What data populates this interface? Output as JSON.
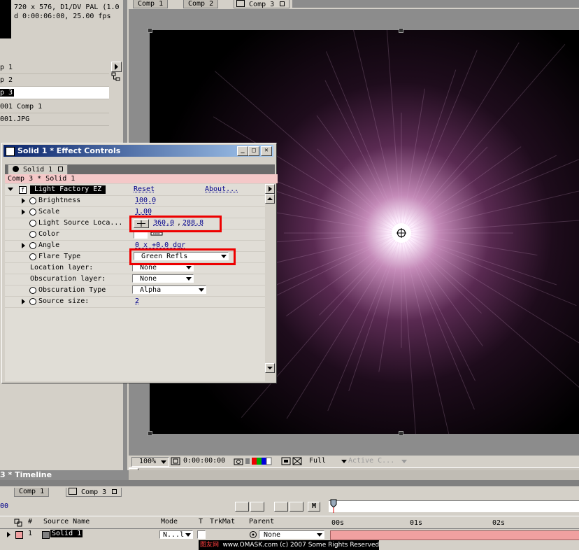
{
  "project": {
    "info_line1": "720 x 576, D1/DV PAL (1.0",
    "info_line2": "d 0:00:06:00, 25.00 fps",
    "items": [
      {
        "label": "p 1",
        "selected": false
      },
      {
        "label": "p 2",
        "selected": false
      },
      {
        "label": "p 3",
        "selected": true
      },
      {
        "label": "001 Comp 1",
        "selected": false
      },
      {
        "label": "001.JPG",
        "selected": false
      }
    ]
  },
  "comp_viewer": {
    "tabs": [
      "Comp 1",
      "Comp 2",
      "Comp 3"
    ],
    "active_tab": "Comp 3",
    "zoom": "100%",
    "timecode": "0:00:00:00",
    "resolution": "Full",
    "camera": "Active C..."
  },
  "effect_controls": {
    "title": "Solid 1 * Effect Controls",
    "tab": "Solid 1",
    "path": "Comp 3 * Solid 1",
    "effect_name": "Light Factory EZ",
    "reset_label": "Reset",
    "about_label": "About...",
    "params": {
      "brightness": {
        "label": "Brightness",
        "value": "100.0"
      },
      "scale": {
        "label": "Scale",
        "value": "1.00"
      },
      "light_source": {
        "label": "Light Source Loca...",
        "x": "360.0",
        "y": "288.8"
      },
      "color": {
        "label": "Color"
      },
      "angle": {
        "label": "Angle",
        "value": "0 x +0.0 dgr"
      },
      "flare_type": {
        "label": "Flare Type",
        "value": "Green Refls"
      },
      "location_layer": {
        "label": "Location layer:",
        "value": "None"
      },
      "obscuration_layer": {
        "label": "Obscuration layer:",
        "value": "None"
      },
      "obscuration_type": {
        "label": "Obscuration Type",
        "value": "Alpha"
      },
      "source_size": {
        "label": "Source size:",
        "value": "2"
      }
    }
  },
  "timeline": {
    "title": "3 * Timeline",
    "tabs": [
      "Comp 1",
      "Comp 3"
    ],
    "current_time": "00",
    "columns": {
      "source_name": "Source Name",
      "mode": "Mode",
      "t": "T",
      "trkmat": "TrkMat",
      "parent": "Parent"
    },
    "ruler": [
      "00s",
      "01s",
      "02s"
    ],
    "layer": {
      "index": "1",
      "name": "Solid 1",
      "mode": "N...l",
      "parent": "None"
    }
  },
  "watermark": {
    "site_cn": "图友网",
    "text": "www.OMASK.com (c) 2007 Some Rights Reserved"
  },
  "colors": {
    "title_bar": "#0a246a",
    "highlight_box": "#e00000",
    "path_bar": "#f4c8c8",
    "layer_bar": "#f0a0a0"
  }
}
